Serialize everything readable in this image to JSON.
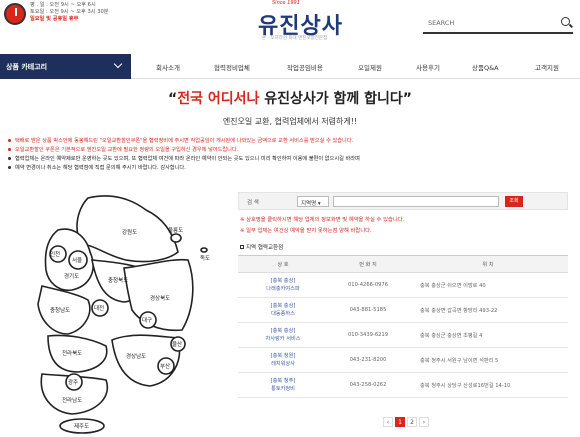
{
  "header": {
    "hours_line1": "평 . 일 : 오전 9시 ~ 오후 6시",
    "hours_line2": "토요일 : 오전 9시 ~ 오후 3시 30분",
    "hours_line3": "일요일 및 공휴일 휴무",
    "since": "Since 1991",
    "logo": "유진상사",
    "slogan": "온 · 오프라인 최대 엔진오일전문점",
    "search_placeholder": "SEARCH"
  },
  "nav": {
    "category": "상품 카테고리",
    "items": [
      "회사소개",
      "협력정비업체",
      "작업공임비용",
      "오일제원",
      "사용후기",
      "상품Q&A",
      "고객지원"
    ]
  },
  "headline": {
    "open_quote": "“",
    "accent": "전국 어디서나",
    "rest": " 유진상사가 함께 합니다”",
    "sub": "엔진오일 교환, 협력업체에서 저렴하게!!"
  },
  "notes": [
    "택배로 받은 상품 박스안에 동봉해드린 \"오일교환할인쿠폰\"을 협력정비에 주시면 작업공임이 게시된에 나와있는 금액으로 교환 서비스를 받으실 수 있습니다.",
    "오일교환할인 쿠폰은 기본적으로 엔진오일 교환에 필요한 정량의 오일을 구입하신 경우에 넣어드립니다.",
    "협력업체는 온라인 예약제로만 운영하는 곳도 있으며, 또 협력업체 여건에 따라 온라인 예약이 안되는 곳도 있으니 미리 확인하여 이용에 불편이 없으시길 바라며",
    "예약 변경이나 취소는 해당 협력점에 직접 문의해 주시기 바랍니다. 감사합니다."
  ],
  "map": {
    "regions": [
      "인천",
      "서울",
      "경기도",
      "강원도",
      "울릉도",
      "독도",
      "충청북도",
      "충청남도",
      "대전",
      "경상북도",
      "전라북도",
      "대구",
      "울산",
      "경상남도",
      "광주",
      "부산",
      "전라남도",
      "제주도"
    ]
  },
  "search_box": {
    "label": "검 색",
    "select_value": "지역명",
    "button": "조회"
  },
  "warnings": [
    "※ 상호명을 클릭하시면 해당 업체의 정보화면 및 예약을 하실 수 있습니다.",
    "※ 일부 업체는 여건상 예약을 받지 못하는점 양해 바랍니다."
  ],
  "section_title": "지역 협력교환점",
  "table": {
    "headers": [
      "상 호",
      "번 화 지",
      "위 치"
    ],
    "rows": [
      {
        "region": "[충북 충상]",
        "name": "나래충카야스파",
        "phone": "010-4266-0976",
        "addr": "충북 충상군 쉬으면 이방로 40"
      },
      {
        "region": "[충북 충상]",
        "name": "대동종하스",
        "phone": "043-881-5185",
        "addr": "충북 충상면 갑곡면 항망리 493-22"
      },
      {
        "region": "[충북 충상]",
        "name": "차사랑카 서비스",
        "phone": "010-3439-6219",
        "addr": "충북 충상군 충상면 초평길 4"
      },
      {
        "region": "[충북 청원]",
        "name": "레치워상사",
        "phone": "043-231-8200",
        "addr": "충북 청주시 서원구 남이면 석판리 5"
      },
      {
        "region": "[충북 청주]",
        "name": "통토카정비",
        "phone": "043-258-0262",
        "addr": "충북 청주시 상당구 산성로16번길 14-10"
      }
    ]
  },
  "pager": {
    "prev": "‹",
    "current": "1",
    "next_page": "2",
    "next": "›"
  }
}
